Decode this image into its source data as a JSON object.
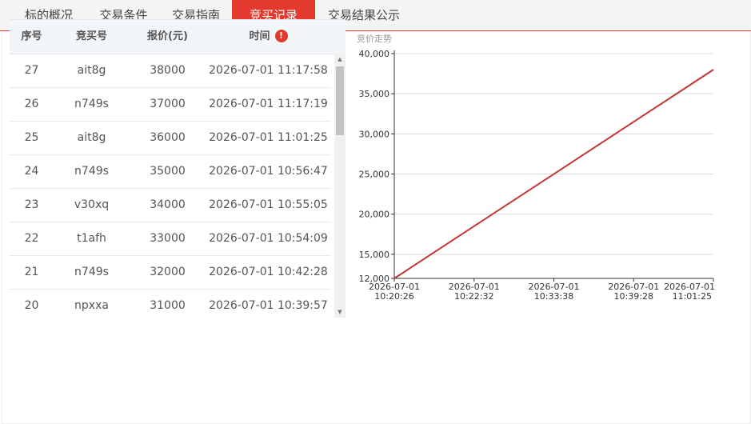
{
  "tabs": [
    {
      "label": "标的概况",
      "active": false
    },
    {
      "label": "交易条件",
      "active": false
    },
    {
      "label": "交易指南",
      "active": false
    },
    {
      "label": "竞买记录",
      "active": true
    },
    {
      "label": "交易结果公示",
      "active": false
    }
  ],
  "table": {
    "headers": {
      "seq": "序号",
      "bidder": "竞买号",
      "price": "报价(元)",
      "time": "时间"
    },
    "rows": [
      {
        "seq": "27",
        "bidder": "ait8g",
        "price": "38000",
        "time": "2026-07-01 11:17:58"
      },
      {
        "seq": "26",
        "bidder": "n749s",
        "price": "37000",
        "time": "2026-07-01 11:17:19"
      },
      {
        "seq": "25",
        "bidder": "ait8g",
        "price": "36000",
        "time": "2026-07-01 11:01:25"
      },
      {
        "seq": "24",
        "bidder": "n749s",
        "price": "35000",
        "time": "2026-07-01 10:56:47"
      },
      {
        "seq": "23",
        "bidder": "v30xq",
        "price": "34000",
        "time": "2026-07-01 10:55:05"
      },
      {
        "seq": "22",
        "bidder": "t1afh",
        "price": "33000",
        "time": "2026-07-01 10:54:09"
      },
      {
        "seq": "21",
        "bidder": "n749s",
        "price": "32000",
        "time": "2026-07-01 10:42:28"
      },
      {
        "seq": "20",
        "bidder": "npxxa",
        "price": "31000",
        "time": "2026-07-01 10:39:57"
      }
    ]
  },
  "icons": {
    "warning": "!",
    "scroll_up": "▲",
    "scroll_down": "▼"
  },
  "colors": {
    "accent": "#e23a2e",
    "line": "#c23531"
  },
  "chart_data": {
    "type": "line",
    "title": "竞价走势",
    "y_ticks": [
      "40,000",
      "35,000",
      "30,000",
      "25,000",
      "20,000",
      "15,000",
      "12,000"
    ],
    "y_tick_values": [
      40000,
      35000,
      30000,
      25000,
      20000,
      15000,
      12000
    ],
    "ylim": [
      12000,
      40000
    ],
    "x_ticks": [
      {
        "date": "2026-07-01",
        "time": "10:20:26"
      },
      {
        "date": "2026-07-01",
        "time": "10:22:32"
      },
      {
        "date": "2026-07-01",
        "time": "10:33:38"
      },
      {
        "date": "2026-07-01",
        "time": "10:39:28"
      },
      {
        "date": "2026-07-01",
        "time": "11:01:25"
      }
    ],
    "series": [
      {
        "x_start": "10:20:26",
        "y_start": 12000,
        "y_end": 38000
      }
    ]
  }
}
